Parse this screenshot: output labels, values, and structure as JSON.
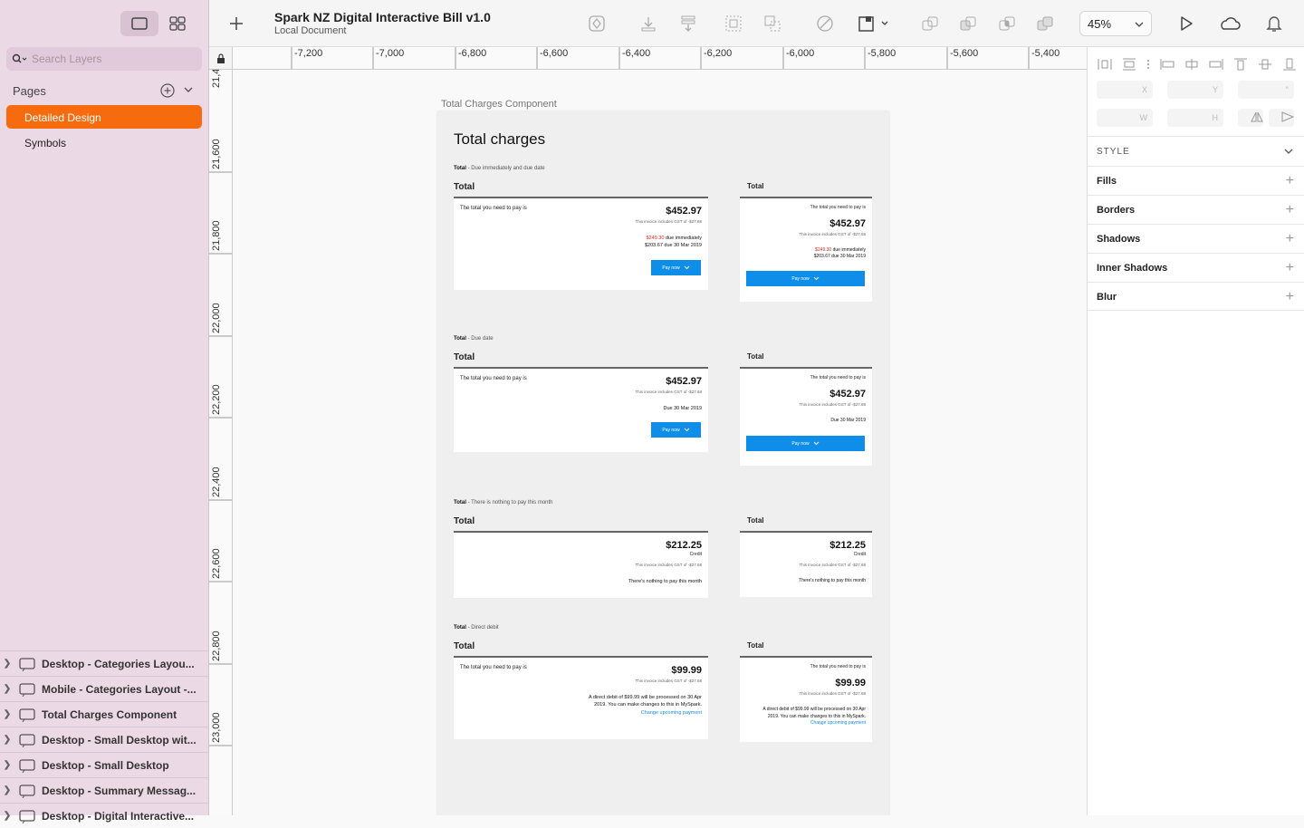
{
  "sidebar": {
    "search_placeholder": "Search Layers",
    "pages_heading": "Pages",
    "pages": [
      "Detailed Design",
      "Symbols"
    ],
    "layers": [
      "Desktop - Categories Layou...",
      "Mobile - Categories Layout -...",
      "Total Charges Component",
      "Desktop - Small Desktop wit...",
      "Desktop - Small Desktop",
      "Desktop - Summary Messag...",
      "Desktop - Digital Interactive..."
    ]
  },
  "toolbar": {
    "title": "Spark NZ Digital Interactive Bill v1.0",
    "subtitle": "Local Document",
    "zoom": "45%"
  },
  "rulers": {
    "horizontal": [
      "-7,200",
      "-7,000",
      "-6,800",
      "-6,600",
      "-6,400",
      "-6,200",
      "-6,000",
      "-5,800",
      "-5,600",
      "-5,400"
    ],
    "vertical": [
      "21,4",
      "21,600",
      "21,800",
      "22,000",
      "22,200",
      "22,400",
      "22,600",
      "22,800",
      "23,000"
    ]
  },
  "artboard": {
    "label": "Total Charges Component",
    "title": "Total charges",
    "total_word": "Total",
    "pay_label": "The total you need to pay is",
    "gst": "This invoice includes GST of -$27.68",
    "pay_now": "Pay now",
    "credit": "Credit",
    "sections": [
      {
        "label": "- Due immediately and due date",
        "amount": "$452.97",
        "due_immediate": "$249.30",
        "due_immediate_suffix": " due immediately",
        "due_later": "$203.67 due 30 Mar 2019"
      },
      {
        "label": "- Due date",
        "amount": "$452.97",
        "due": "Due 30 Mar 2019"
      },
      {
        "label": "- There is nothing to pay this month",
        "amount": "$212.25",
        "nothing": "There's nothing to pay this month"
      },
      {
        "label": "- Direct debit",
        "amount": "$99.99",
        "dd_desktop": "A direct debit of $99.99 will be processed on 30 Apr 2019. You can make changes to this in MySpark.",
        "dd_mobile": "A direct debit of $99.99 will be processed on 30 Apr 2019. You can make changes to this in MySpark.",
        "link": "Change upcoming payment"
      }
    ]
  },
  "inspector": {
    "fields": [
      "X",
      "Y",
      "°",
      "W",
      "H"
    ],
    "style_heading": "STYLE",
    "properties": [
      "Fills",
      "Borders",
      "Shadows",
      "Inner Shadows",
      "Blur"
    ]
  },
  "colors": {
    "accent": "#f76b0f",
    "button": "#0f8ee9",
    "due_red": "#e0261b"
  }
}
